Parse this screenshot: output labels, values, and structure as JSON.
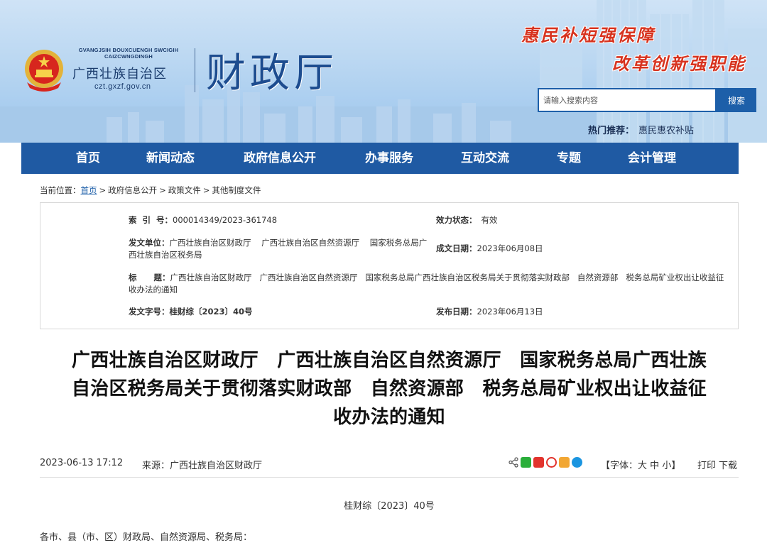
{
  "header": {
    "brand_en_line1": "GVANGJSIH BOUXCUENGH SWCIGIH",
    "brand_en_line2": "CAIZCWNGDINGH",
    "brand_cn": "广西壮族自治区",
    "brand_url": "czt.gxzf.gov.cn",
    "dept_name": "财政厅",
    "slogan_1": "惠民补短强保障",
    "slogan_2": "改革创新强职能",
    "search_placeholder": "请输入搜索内容",
    "search_button": "搜索",
    "hot_label": "热门推荐：",
    "hot_link": "惠民惠农补贴"
  },
  "nav": {
    "items": [
      "首页",
      "新闻动态",
      "政府信息公开",
      "办事服务",
      "互动交流",
      "专题",
      "会计管理"
    ]
  },
  "breadcrumb": {
    "prefix": "当前位置：",
    "items": [
      "首页",
      "政府信息公开",
      "政策文件",
      "其他制度文件"
    ]
  },
  "meta": {
    "index_label": "索  引  号：",
    "index_value": "000014349/2023-361748",
    "status_label": "效力状态：",
    "status_value": "有效",
    "issuer_label": "发文单位：",
    "issuer_value": "广西壮族自治区财政厅    广西壮族自治区自然资源厅    国家税务总局广西壮族自治区税务局",
    "created_label": "成文日期：",
    "created_value": "2023年06月08日",
    "title_label": "标      题：",
    "title_value": "广西壮族自治区财政厅   广西壮族自治区自然资源厅   国家税务总局广西壮族自治区税务局关于贯彻落实财政部   自然资源部   税务总局矿业权出让收益征收办法的通知",
    "docno_label": "发文字号：",
    "docno_value": "桂财综〔2023〕40号",
    "published_label": "发布日期：",
    "published_value": "2023年06月13日"
  },
  "document": {
    "title": "广西壮族自治区财政厅　广西壮族自治区自然资源厅　国家税务总局广西壮族\n自治区税务局关于贯彻落实财政部　自然资源部　税务总局矿业权出让收益征\n收办法的通知",
    "datetime": "2023-06-13 17:12",
    "source_label": "来源：",
    "source_value": "广西壮族自治区财政厅",
    "font_open": "【字体：",
    "font_large": "大",
    "font_medium": "中",
    "font_small": "小",
    "font_close": "】",
    "print_label": "打印",
    "download_label": "下载",
    "doc_number": "桂财综〔2023〕40号",
    "salutation": "各市、县（市、区）财政局、自然资源局、税务局："
  },
  "colors": {
    "nav_bg": "#1f5aa3",
    "accent": "#1d5fa9",
    "slogan": "#d7331f"
  }
}
